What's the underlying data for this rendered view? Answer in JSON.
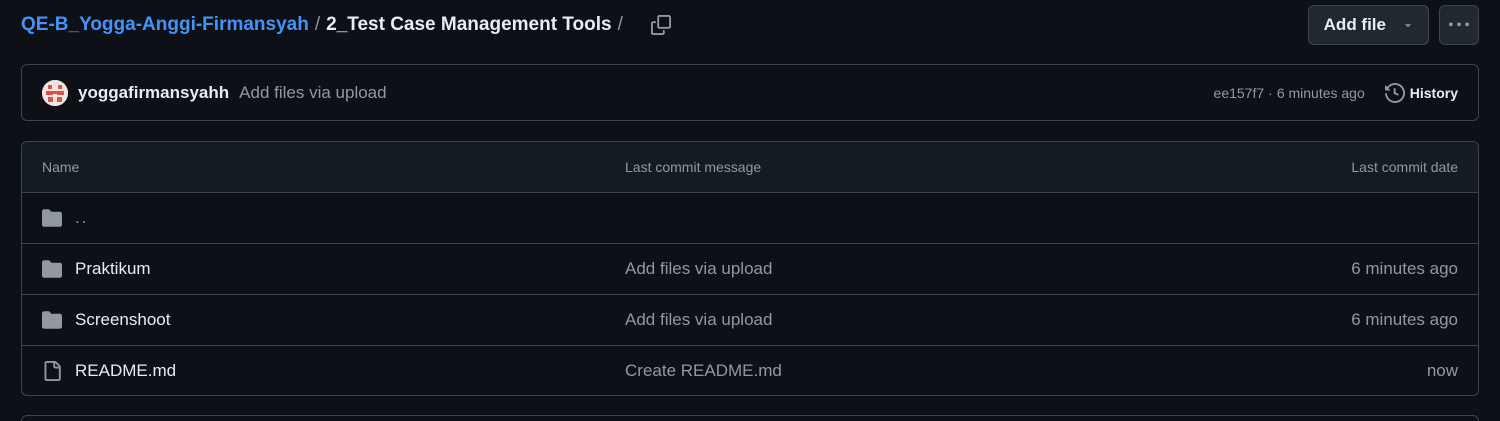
{
  "breadcrumb": {
    "repo": "QE-B_Yogga-Anggi-Firmansyah",
    "separator": "/",
    "current": "2_Test Case Management Tools",
    "trailing_separator": "/"
  },
  "actions": {
    "add_file_label": "Add file",
    "more_label": "More options"
  },
  "latest_commit": {
    "author": "yoggafirmansyahh",
    "message": "Add files via upload",
    "sha": "ee157f7",
    "separator": "·",
    "time": "6 minutes ago",
    "history_label": "History"
  },
  "table": {
    "headers": {
      "name": "Name",
      "message": "Last commit message",
      "date": "Last commit date"
    },
    "parent_dir": "..",
    "rows": [
      {
        "name": "Praktikum",
        "type": "folder",
        "message": "Add files via upload",
        "date": "6 minutes ago"
      },
      {
        "name": "Screenshoot",
        "type": "folder",
        "message": "Add files via upload",
        "date": "6 minutes ago"
      },
      {
        "name": "README.md",
        "type": "file",
        "message": "Create README.md",
        "date": "now"
      }
    ]
  },
  "colors": {
    "background": "#0d1117",
    "link": "#4493f8",
    "border": "#3d444d",
    "muted_text": "#9198a1",
    "text": "#e6edf3",
    "folder_icon": "#9198a1"
  },
  "icons": {
    "copy": "copy-icon",
    "caret": "triangle-down-icon",
    "kebab": "kebab-horizontal-icon",
    "history": "history-icon",
    "folder": "folder-icon",
    "file": "file-icon"
  }
}
